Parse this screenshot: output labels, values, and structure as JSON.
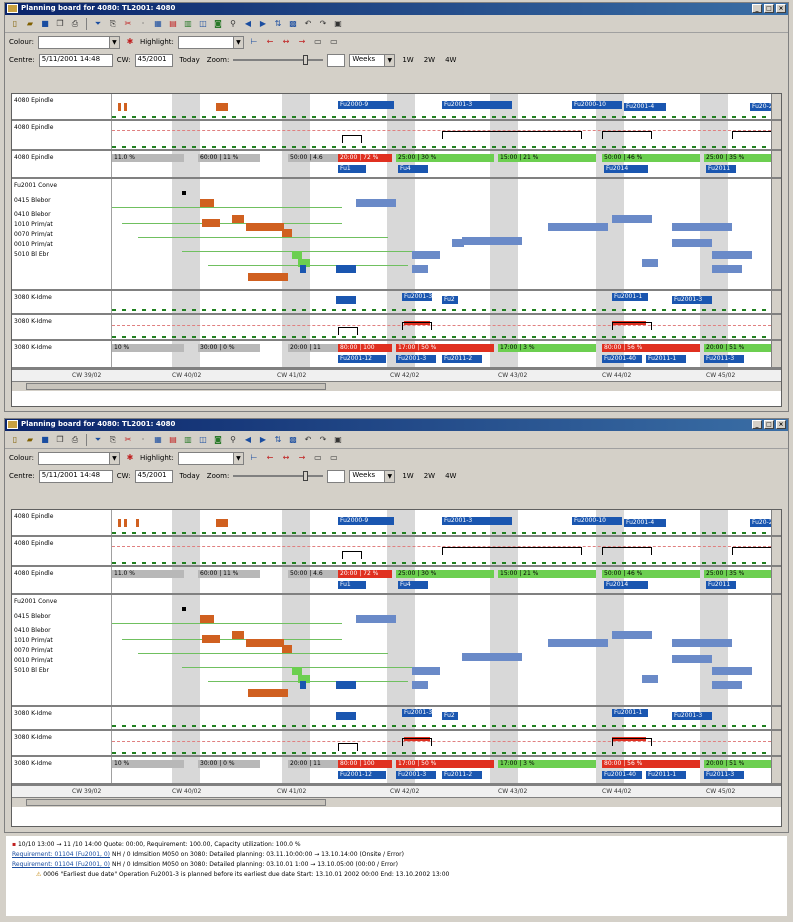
{
  "windows": [
    {
      "title": "Planning board for 4080: TL2001: 4080"
    },
    {
      "title": "Planning board for 4080: TL2001: 4080"
    }
  ],
  "toolbar": {
    "colour_label": "Colour:",
    "highlight_label": "Highlight:",
    "centre_label": "Centre:",
    "centre_value": "5/11/2001 14:48",
    "cw_label": "CW:",
    "cw_value": "45/2001",
    "today_label": "Today",
    "zoom_label": "Zoom:",
    "zoom_unit": "Weeks",
    "scale_buttons": [
      "1W",
      "2W",
      "4W"
    ]
  },
  "lanes": {
    "res1": "4080 Epindle",
    "res1b": "4080 Epindle",
    "res1c": "4080 Epindle",
    "order": "Fu2001 Conve",
    "ops": [
      "0415 Blebor",
      "0410 Blebor",
      "1010 Prim/at",
      "0070 Prim/at",
      "0010 Prim/at",
      "5010 Bl Ebr"
    ],
    "res2": "3080 K-Idme",
    "res2b": "3080 K-Idme",
    "res2c": "3080 K-Idme"
  },
  "bars": {
    "top": [
      "Fu2000-9",
      "Fu2001-3",
      "Fu2000-10",
      "Fu2001-4",
      "Fu20-2"
    ],
    "cap1": [
      "11.0 %",
      "60:00 | 11 %",
      "50:00 | 4.6",
      "20:00 | 72 %",
      "25:00 | 30 %",
      "15:00 | 21 %",
      "50:00 | 46 %",
      "25:00 | 35 %"
    ],
    "cap1sub": [
      "Fu1",
      "Fu4",
      "Fu2014",
      "Fu2011"
    ],
    "mid": [
      "Fu2001-3",
      "Fu2",
      "Fu2001-1",
      "Fu2001-3"
    ],
    "cap2": [
      "10 %",
      "30:00 | 0 %",
      "20:00 | 11",
      "80:00 | 100",
      "17:00 | 50 %",
      "17:00 | 3 %",
      "80:00 | 56 %",
      "20:00 | 51 %"
    ],
    "cap2sub": [
      "Fu2001-12",
      "Fu2001-3",
      "Fu2011-2",
      "Fu2001-40",
      "Fu2011-1",
      "Fu2011-3"
    ]
  },
  "axis": [
    "CW 39/02",
    "CW 40/02",
    "CW 41/02",
    "CW 42/02",
    "CW 43/02",
    "CW 44/02",
    "CW 45/02"
  ],
  "log": [
    {
      "icon": "",
      "text": "10/10 13:00 → 11 /10 14:00 Quote: 00:00, Requirement: 100.00, Capacity utilization: 100.0 %"
    },
    {
      "link": "Requirement: 01104 (Fu2001, 0)",
      "text": "NH / 0 Idmsition M050 on 3080: Detailed planning: 03.11.10:00:00 → 13.10.14:00 (Onsite / Error)"
    },
    {
      "link": "Requirement: 01104 (Fu2001, 0)",
      "text": "NH / 0 Idmsition M050 on 3080: Detailed planning: 03.10.01 1:00 → 13.10.05:00 (00:00 / Error)"
    },
    {
      "icon": "",
      "text": "0006 \"Earliest due date\" Operation Fu2001-3 is planned before its earliest due date Start: 13.10.01 2002 00:00 End: 13.10.2002 13:00"
    }
  ]
}
